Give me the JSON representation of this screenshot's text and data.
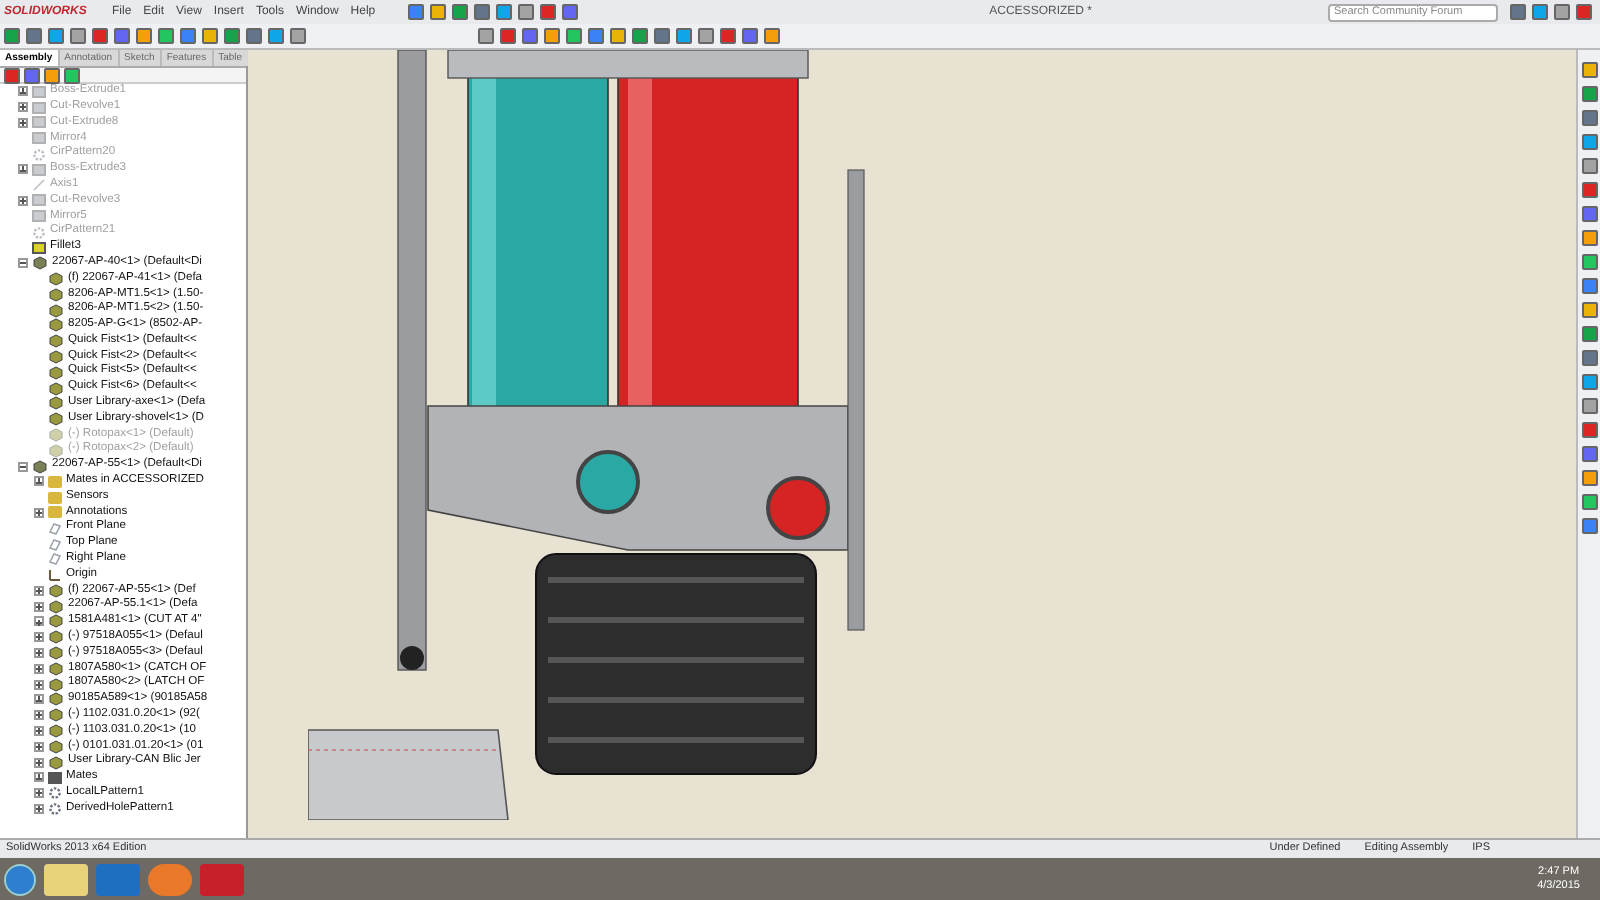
{
  "app": {
    "logo": "SOLIDWORKS",
    "menu": [
      "File",
      "Edit",
      "View",
      "Insert",
      "Tools",
      "Window",
      "Help"
    ],
    "document_title": "ACCESSORIZED *",
    "search": {
      "placeholder": "Search Community Forum"
    }
  },
  "tabs": [
    {
      "label": "Assembly",
      "selected": true
    },
    {
      "label": "Annotation",
      "selected": false
    },
    {
      "label": "Sketch",
      "selected": false
    },
    {
      "label": "Features",
      "selected": false
    },
    {
      "label": "Table",
      "selected": false
    }
  ],
  "tree": [
    {
      "label": "Boss-Extrude1",
      "kind": "feature",
      "suppressed": true,
      "expanded": false
    },
    {
      "label": "Cut-Revolve1",
      "kind": "feature",
      "suppressed": true,
      "expanded": false
    },
    {
      "label": "Cut-Extrude8",
      "kind": "feature",
      "suppressed": true,
      "expanded": false
    },
    {
      "label": "Mirror4",
      "kind": "feature",
      "suppressed": true
    },
    {
      "label": "CirPattern20",
      "kind": "pattern",
      "suppressed": true
    },
    {
      "label": "Boss-Extrude3",
      "kind": "feature",
      "suppressed": true,
      "expanded": false
    },
    {
      "label": "Axis1",
      "kind": "axis",
      "suppressed": true
    },
    {
      "label": "Cut-Revolve3",
      "kind": "feature",
      "suppressed": true,
      "expanded": false
    },
    {
      "label": "Mirror5",
      "kind": "feature",
      "suppressed": true
    },
    {
      "label": "CirPattern21",
      "kind": "pattern",
      "suppressed": true
    },
    {
      "label": "Fillet3",
      "kind": "fillet",
      "suppressed": false
    },
    {
      "label": "22067-AP-40<1> (Default<Di",
      "kind": "assembly",
      "suppressed": false,
      "expanded": true,
      "children": [
        {
          "label": "(f) 22067-AP-41<1> (Defa",
          "kind": "component",
          "suppressed": false
        },
        {
          "label": "8206-AP-MT1.5<1> (1.50-",
          "kind": "component",
          "suppressed": false
        },
        {
          "label": "8206-AP-MT1.5<2> (1.50-",
          "kind": "component",
          "suppressed": false
        },
        {
          "label": "8205-AP-G<1> (8502-AP-",
          "kind": "component",
          "suppressed": false
        },
        {
          "label": "Quick Fist<1> (Default<<",
          "kind": "component",
          "suppressed": false
        },
        {
          "label": "Quick Fist<2> (Default<<",
          "kind": "component",
          "suppressed": false
        },
        {
          "label": "Quick Fist<5> (Default<<",
          "kind": "component",
          "suppressed": false
        },
        {
          "label": "Quick Fist<6> (Default<<",
          "kind": "component",
          "suppressed": false
        },
        {
          "label": "User Library-axe<1> (Defa",
          "kind": "component",
          "suppressed": false
        },
        {
          "label": "User Library-shovel<1> (D",
          "kind": "component",
          "suppressed": false
        },
        {
          "label": "(-) Rotopax<1> (Default)",
          "kind": "component",
          "suppressed": true
        },
        {
          "label": "(-) Rotopax<2> (Default)",
          "kind": "component",
          "suppressed": true
        }
      ]
    },
    {
      "label": "22067-AP-55<1> (Default<Di",
      "kind": "assembly",
      "suppressed": false,
      "expanded": true,
      "children": [
        {
          "label": "Mates in ACCESSORIZED",
          "kind": "folder",
          "suppressed": false,
          "expanded": false
        },
        {
          "label": "Sensors",
          "kind": "folder",
          "suppressed": false
        },
        {
          "label": "Annotations",
          "kind": "folder",
          "suppressed": false,
          "expanded": false
        },
        {
          "label": "Front Plane",
          "kind": "plane",
          "suppressed": false
        },
        {
          "label": "Top Plane",
          "kind": "plane",
          "suppressed": false
        },
        {
          "label": "Right Plane",
          "kind": "plane",
          "suppressed": false
        },
        {
          "label": "Origin",
          "kind": "origin",
          "suppressed": false
        },
        {
          "label": "(f) 22067-AP-55<1> (Def",
          "kind": "component",
          "suppressed": false,
          "expanded": false
        },
        {
          "label": "22067-AP-55.1<1> (Defa",
          "kind": "component",
          "suppressed": false,
          "expanded": false
        },
        {
          "label": "1581A481<1> (CUT AT 4\"",
          "kind": "component",
          "suppressed": false,
          "expanded": false
        },
        {
          "label": "(-) 97518A055<1> (Defaul",
          "kind": "component",
          "suppressed": false,
          "expanded": false
        },
        {
          "label": "(-) 97518A055<3> (Defaul",
          "kind": "component",
          "suppressed": false,
          "expanded": false
        },
        {
          "label": "1807A580<1> (CATCH OF",
          "kind": "component",
          "suppressed": false,
          "expanded": false
        },
        {
          "label": "1807A580<2> (LATCH OF",
          "kind": "component",
          "suppressed": false,
          "expanded": false
        },
        {
          "label": "90185A589<1> (90185A58",
          "kind": "component",
          "suppressed": false,
          "expanded": false
        },
        {
          "label": "(-) 1102.031.0.20<1> (92(",
          "kind": "component",
          "suppressed": false,
          "expanded": false
        },
        {
          "label": "(-) 1103.031.0.20<1> (10",
          "kind": "component",
          "suppressed": false,
          "expanded": false
        },
        {
          "label": "(-) 0101.031.01.20<1> (01",
          "kind": "component",
          "suppressed": false,
          "expanded": false
        },
        {
          "label": "User Library-CAN Blic Jer",
          "kind": "component",
          "suppressed": false,
          "expanded": false
        },
        {
          "label": "Mates",
          "kind": "mates",
          "suppressed": false,
          "expanded": false
        },
        {
          "label": "LocalLPattern1",
          "kind": "pattern",
          "suppressed": false,
          "expanded": false
        },
        {
          "label": "DerivedHolePattern1",
          "kind": "pattern",
          "suppressed": false,
          "expanded": false
        }
      ]
    }
  ],
  "status_bar": {
    "edition": "SolidWorks 2013 x64 Edition",
    "fields": [
      "Under Defined",
      "Editing Assembly",
      "IPS"
    ]
  },
  "taskbar": {
    "time": "2:47 PM",
    "date": "4/3/2015"
  }
}
